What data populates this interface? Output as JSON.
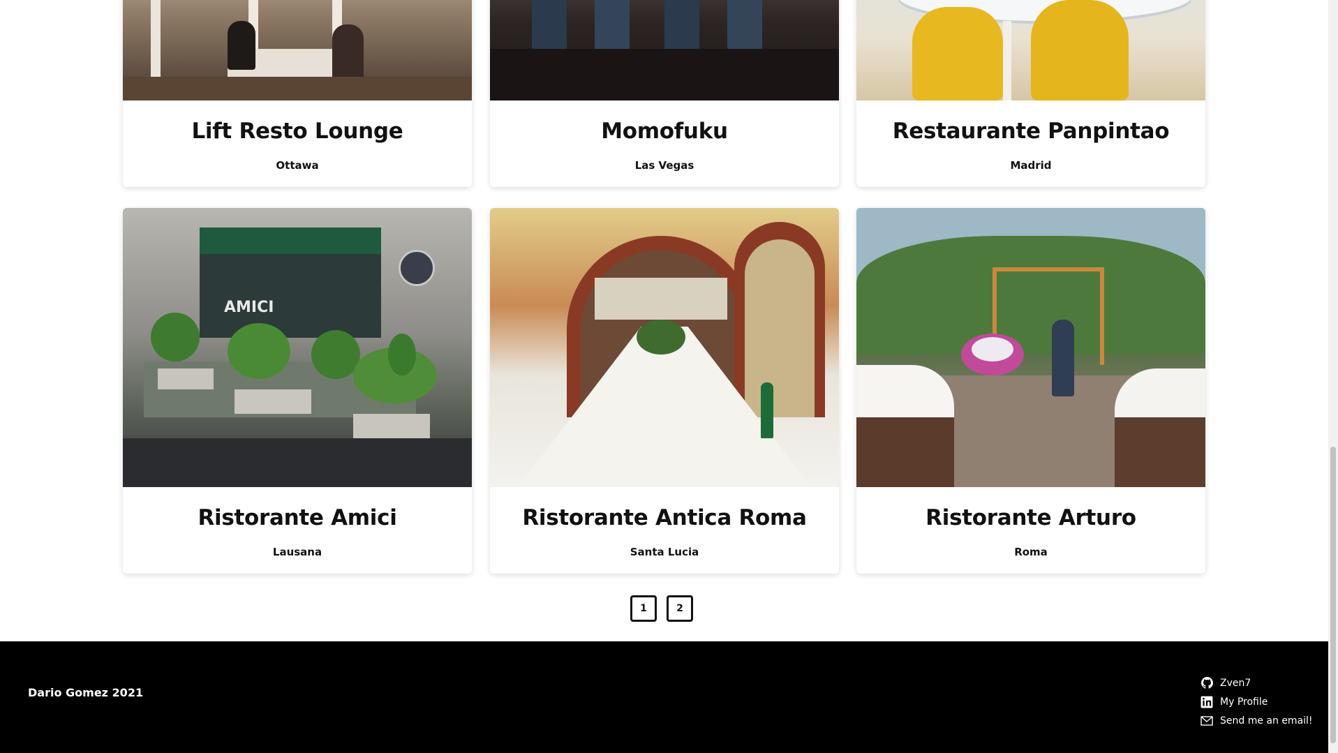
{
  "restaurants": [
    {
      "name": "Lift Resto Lounge",
      "city": "Ottawa"
    },
    {
      "name": "Momofuku",
      "city": "Las Vegas"
    },
    {
      "name": "Restaurante Panpintao",
      "city": "Madrid"
    },
    {
      "name": "Ristorante Amici",
      "city": "Lausana"
    },
    {
      "name": "Ristorante Antica Roma",
      "city": "Santa Lucia"
    },
    {
      "name": "Ristorante Arturo",
      "city": "Roma"
    }
  ],
  "pagination": {
    "pages": [
      "1",
      "2"
    ]
  },
  "footer": {
    "copyright": "Dario Gomez 2021",
    "links": [
      {
        "icon": "github-icon",
        "label": "Zven7"
      },
      {
        "icon": "linkedin-icon",
        "label": "My Profile"
      },
      {
        "icon": "mail-icon",
        "label": "Send me an email!"
      }
    ]
  },
  "colors": {
    "footer_bg": "#000000",
    "card_bg": "#ffffff",
    "text": "#111111"
  }
}
